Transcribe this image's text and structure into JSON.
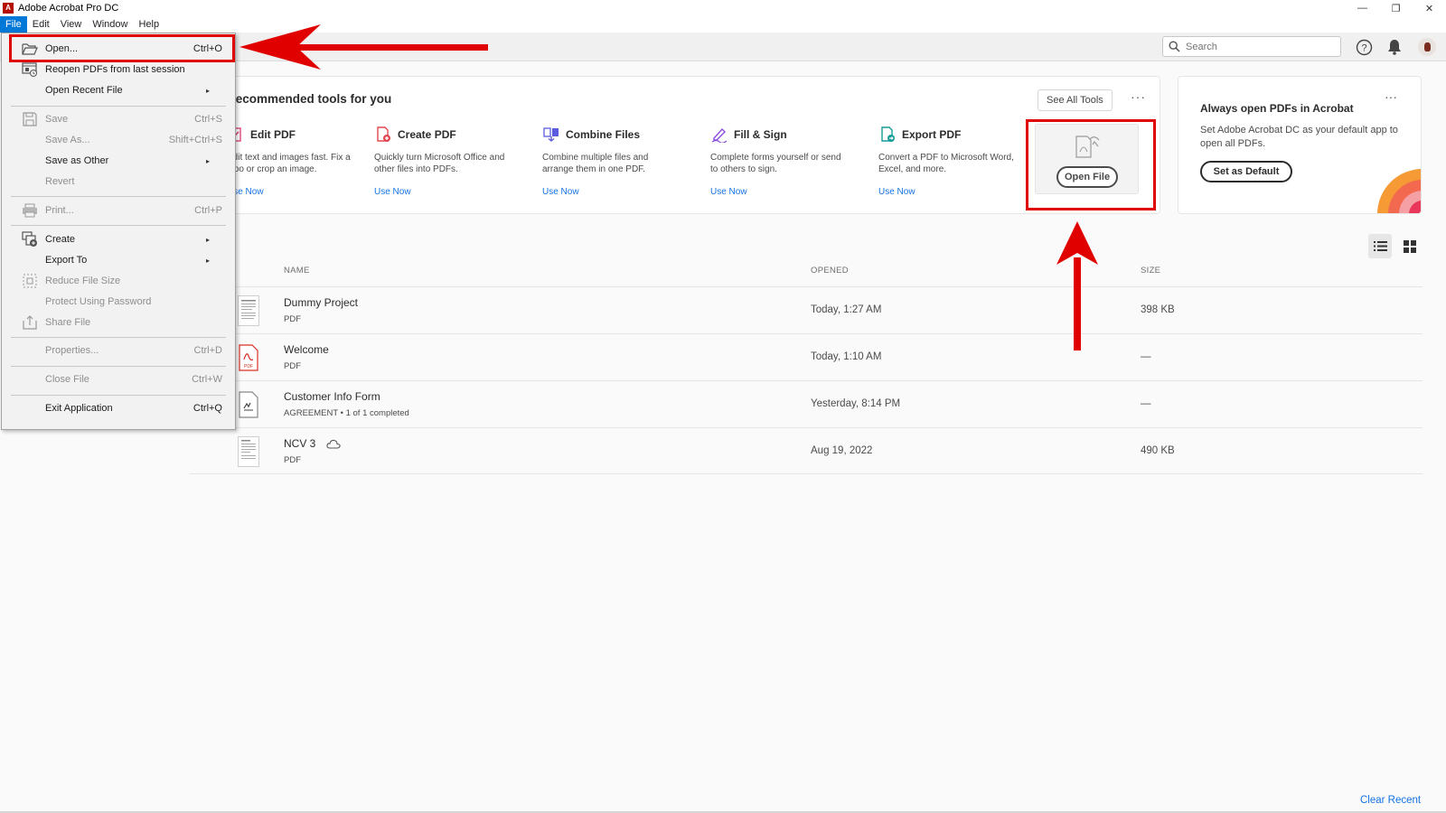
{
  "window": {
    "title": "Adobe Acrobat Pro DC",
    "logo": "acrobat-logo",
    "minimize": "—",
    "restore": "❐",
    "close": "✕"
  },
  "menubar": [
    "File",
    "Edit",
    "View",
    "Window",
    "Help"
  ],
  "toolbar": {
    "search_placeholder": "Search"
  },
  "tools_card": {
    "heading": "Recommended tools for you",
    "see_all": "See All Tools",
    "more": "···",
    "tools": [
      {
        "name": "Edit PDF",
        "desc": "Edit text and images fast. Fix a typo or crop an image.",
        "link": "Use Now",
        "icon": "edit-pdf-icon",
        "color": "#e04a7d"
      },
      {
        "name": "Create PDF",
        "desc": "Quickly turn Microsoft Office and other files into PDFs.",
        "link": "Use Now",
        "icon": "create-pdf-icon",
        "color": "#e34850"
      },
      {
        "name": "Combine Files",
        "desc": "Combine multiple files and arrange them in one PDF.",
        "link": "Use Now",
        "icon": "combine-files-icon",
        "color": "#5c5ce0"
      },
      {
        "name": "Fill & Sign",
        "desc": "Complete forms yourself or send to others to sign.",
        "link": "Use Now",
        "icon": "fill-sign-icon",
        "color": "#8a4fdb"
      },
      {
        "name": "Export PDF",
        "desc": "Convert a PDF to Microsoft Word, Excel, and more.",
        "link": "Use Now",
        "icon": "export-pdf-icon",
        "color": "#159c97"
      }
    ],
    "open_file": "Open File"
  },
  "default_card": {
    "title": "Always open PDFs in Acrobat",
    "more": "···",
    "desc": "Set Adobe Acrobat DC as your default app to open all PDFs.",
    "button": "Set as Default"
  },
  "recent": {
    "columns": {
      "name": "NAME",
      "opened": "OPENED",
      "size": "SIZE"
    },
    "files": [
      {
        "name": "Dummy Project",
        "type": "PDF",
        "opened": "Today, 1:27 AM",
        "size": "398 KB",
        "thumb": "document-thumbnail",
        "cloud": false
      },
      {
        "name": "Welcome",
        "type": "PDF",
        "opened": "Today, 1:10 AM",
        "size": "—",
        "thumb": "pdf-file-icon",
        "cloud": false
      },
      {
        "name": "Customer Info Form",
        "type": "AGREEMENT  •  1 of 1 completed",
        "opened": "Yesterday, 8:14 PM",
        "size": "—",
        "thumb": "agreement-icon",
        "cloud": false
      },
      {
        "name": "NCV 3",
        "type": "PDF",
        "opened": "Aug 19, 2022",
        "size": "490 KB",
        "thumb": "document-thumbnail",
        "cloud": true
      }
    ],
    "clear": "Clear Recent"
  },
  "file_menu": [
    {
      "label": "Open...",
      "short": "Ctrl+O",
      "icon": "folder-open-icon",
      "disabled": false,
      "sub": false
    },
    {
      "label": "Reopen PDFs from last session",
      "short": "",
      "icon": "reopen-icon",
      "disabled": false,
      "sub": false
    },
    {
      "label": "Open Recent File",
      "short": "",
      "icon": "",
      "disabled": false,
      "sub": true
    },
    {
      "label": "Save",
      "short": "Ctrl+S",
      "icon": "save-icon",
      "disabled": true,
      "sub": false
    },
    {
      "label": "Save As...",
      "short": "Shift+Ctrl+S",
      "icon": "",
      "disabled": true,
      "sub": false
    },
    {
      "label": "Save as Other",
      "short": "",
      "icon": "",
      "disabled": false,
      "sub": true
    },
    {
      "label": "Revert",
      "short": "",
      "icon": "",
      "disabled": true,
      "sub": false
    },
    {
      "label": "Print...",
      "short": "Ctrl+P",
      "icon": "print-icon",
      "disabled": true,
      "sub": false
    },
    {
      "label": "Create",
      "short": "",
      "icon": "create-icon",
      "disabled": false,
      "sub": true
    },
    {
      "label": "Export To",
      "short": "",
      "icon": "",
      "disabled": false,
      "sub": true
    },
    {
      "label": "Reduce File Size",
      "short": "",
      "icon": "reduce-size-icon",
      "disabled": true,
      "sub": false
    },
    {
      "label": "Protect Using Password",
      "short": "",
      "icon": "",
      "disabled": true,
      "sub": false
    },
    {
      "label": "Share File",
      "short": "",
      "icon": "share-icon",
      "disabled": true,
      "sub": false
    },
    {
      "label": "Properties...",
      "short": "Ctrl+D",
      "icon": "",
      "disabled": true,
      "sub": false
    },
    {
      "label": "Close File",
      "short": "Ctrl+W",
      "icon": "",
      "disabled": true,
      "sub": false
    },
    {
      "label": "Exit Application",
      "short": "Ctrl+Q",
      "icon": "",
      "disabled": false,
      "sub": false
    }
  ],
  "colors": {
    "accent": "#1473e6",
    "menu_active": "#0078d7",
    "annotation": "#e00000",
    "acrobat_red": "#b30b00"
  }
}
